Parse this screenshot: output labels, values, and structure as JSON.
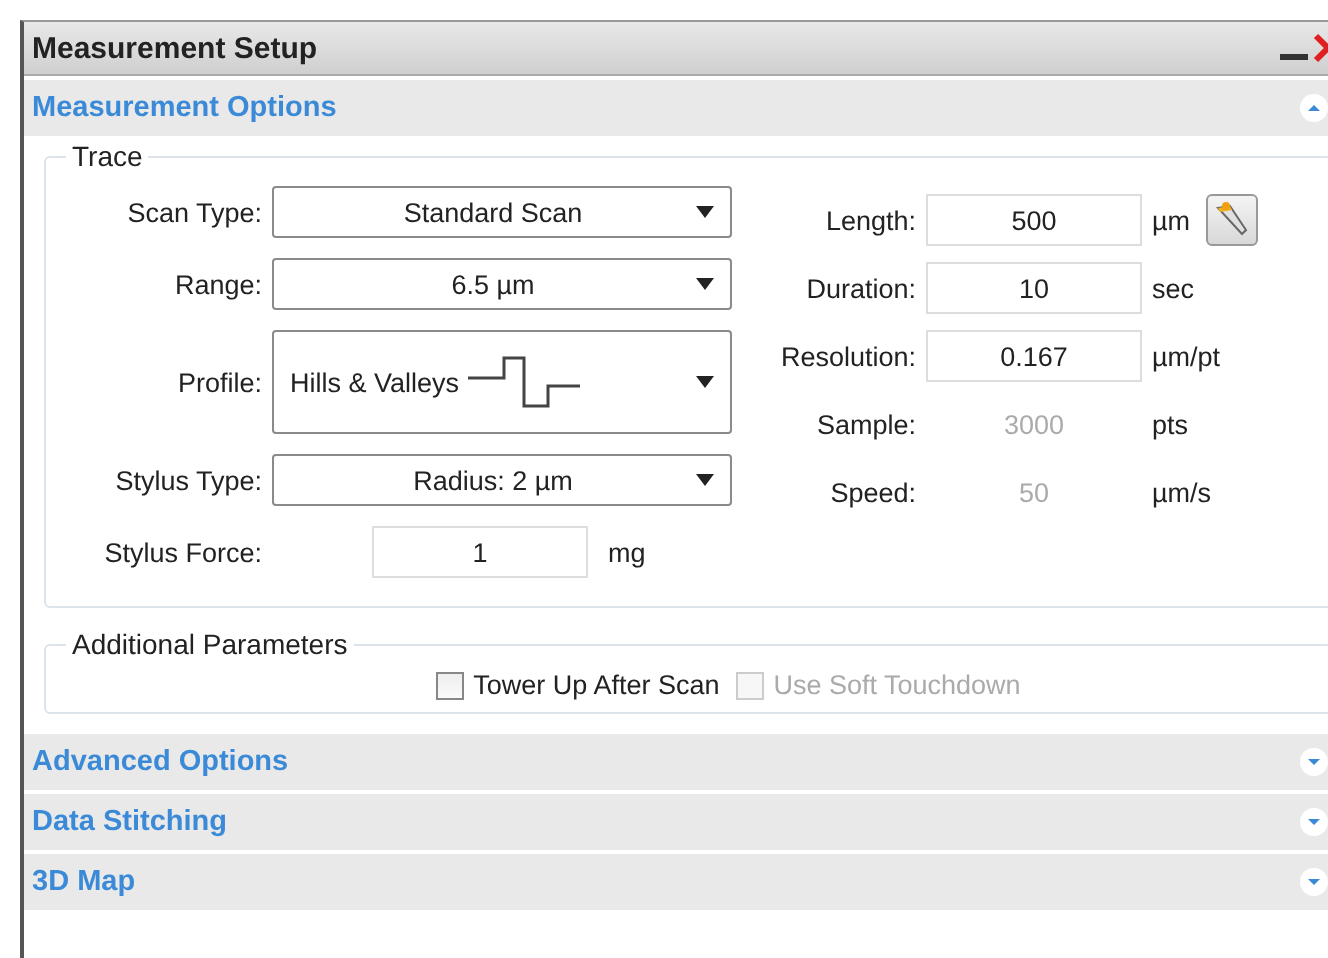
{
  "window": {
    "title": "Measurement Setup"
  },
  "sections": [
    {
      "title": "Measurement Options",
      "expanded": true
    },
    {
      "title": "Advanced Options",
      "expanded": false
    },
    {
      "title": "Data Stitching",
      "expanded": false
    },
    {
      "title": "3D Map",
      "expanded": false
    }
  ],
  "trace": {
    "title": "Trace",
    "left": [
      {
        "kind": "combo",
        "label": "Scan Type:",
        "value": "Standard Scan"
      },
      {
        "kind": "combo",
        "label": "Range:",
        "value": "6.5 µm"
      },
      {
        "kind": "profile",
        "label": "Profile:",
        "value": "Hills & Valleys"
      },
      {
        "kind": "combo",
        "label": "Stylus Type:",
        "value": "Radius: 2 µm"
      },
      {
        "kind": "input",
        "label": "Stylus Force:",
        "value": "1",
        "unit": "mg"
      }
    ],
    "right": [
      {
        "kind": "input",
        "label": "Length:",
        "value": "500",
        "unit": "µm",
        "tool": true
      },
      {
        "kind": "input",
        "label": "Duration:",
        "value": "10",
        "unit": "sec",
        "tool": false
      },
      {
        "kind": "input",
        "label": "Resolution:",
        "value": "0.167",
        "unit": "µm/pt",
        "tool": false
      },
      {
        "kind": "readout",
        "label": "Sample:",
        "value": "3000",
        "unit": "pts",
        "tool": false
      },
      {
        "kind": "readout",
        "label": "Speed:",
        "value": "50",
        "unit": "µm/s",
        "tool": false
      }
    ]
  },
  "additional": {
    "title": "Additional Parameters",
    "checkboxes": [
      {
        "label": "Tower Up After Scan",
        "checked": false,
        "disabled": false
      },
      {
        "label": "Use Soft Touchdown",
        "checked": false,
        "disabled": true
      }
    ]
  }
}
